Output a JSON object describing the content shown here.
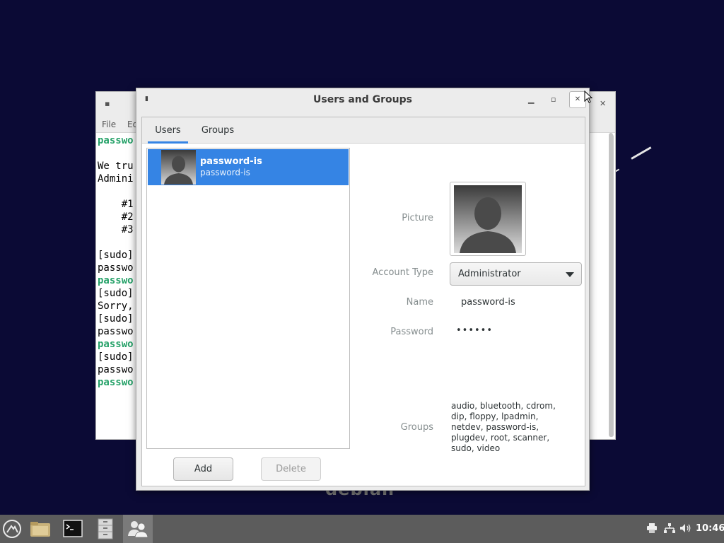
{
  "desktop": {
    "watermark": "debian"
  },
  "terminal": {
    "menu": [
      "File",
      "Ed"
    ],
    "lines": [
      {
        "text": "passwo",
        "style": "g"
      },
      {
        "text": "",
        "style": ""
      },
      {
        "text": "We tru",
        "style": ""
      },
      {
        "text": "Admini",
        "style": ""
      },
      {
        "text": "",
        "style": ""
      },
      {
        "text": "    #1",
        "style": ""
      },
      {
        "text": "    #2",
        "style": ""
      },
      {
        "text": "    #3",
        "style": ""
      },
      {
        "text": "",
        "style": ""
      },
      {
        "text": "[sudo]",
        "style": ""
      },
      {
        "text": "passwo",
        "style": ""
      },
      {
        "text": "passwo",
        "style": "g"
      },
      {
        "text": "[sudo]",
        "style": ""
      },
      {
        "text": "Sorry,",
        "style": ""
      },
      {
        "text": "[sudo]",
        "style": ""
      },
      {
        "text": "passwo",
        "style": ""
      },
      {
        "text": "passwo",
        "style": "g"
      },
      {
        "text": "[sudo]",
        "style": ""
      },
      {
        "text": "passwo",
        "style": ""
      },
      {
        "text": "passwo",
        "style": "g"
      }
    ]
  },
  "dialog": {
    "title": "Users and Groups",
    "tabs": [
      "Users",
      "Groups"
    ],
    "users": [
      {
        "name": "password-is",
        "login": "password-is",
        "selected": true
      }
    ],
    "buttons": {
      "add": "Add",
      "delete": "Delete"
    },
    "details": {
      "picture_label": "Picture",
      "account_type_label": "Account Type",
      "account_type_value": "Administrator",
      "name_label": "Name",
      "name_value": "password-is",
      "password_label": "Password",
      "password_value": "••••••",
      "groups_label": "Groups",
      "groups_value": "audio, bluetooth, cdrom, dip, floppy, lpadmin, netdev, password-is, plugdev, root, scanner, sudo, video"
    }
  },
  "taskbar": {
    "clock": "10:46",
    "apps": [
      "menu-icon",
      "files-folder-icon",
      "terminal-icon",
      "file-cabinet-icon",
      "users-groups-icon"
    ],
    "tray": [
      "printer-icon",
      "network-icon",
      "volume-icon"
    ]
  },
  "colors": {
    "accent": "#3584e4",
    "desktop_bg": "#0b0a35",
    "taskbar_bg": "#5c5c5c",
    "terminal_green": "#26a269"
  }
}
